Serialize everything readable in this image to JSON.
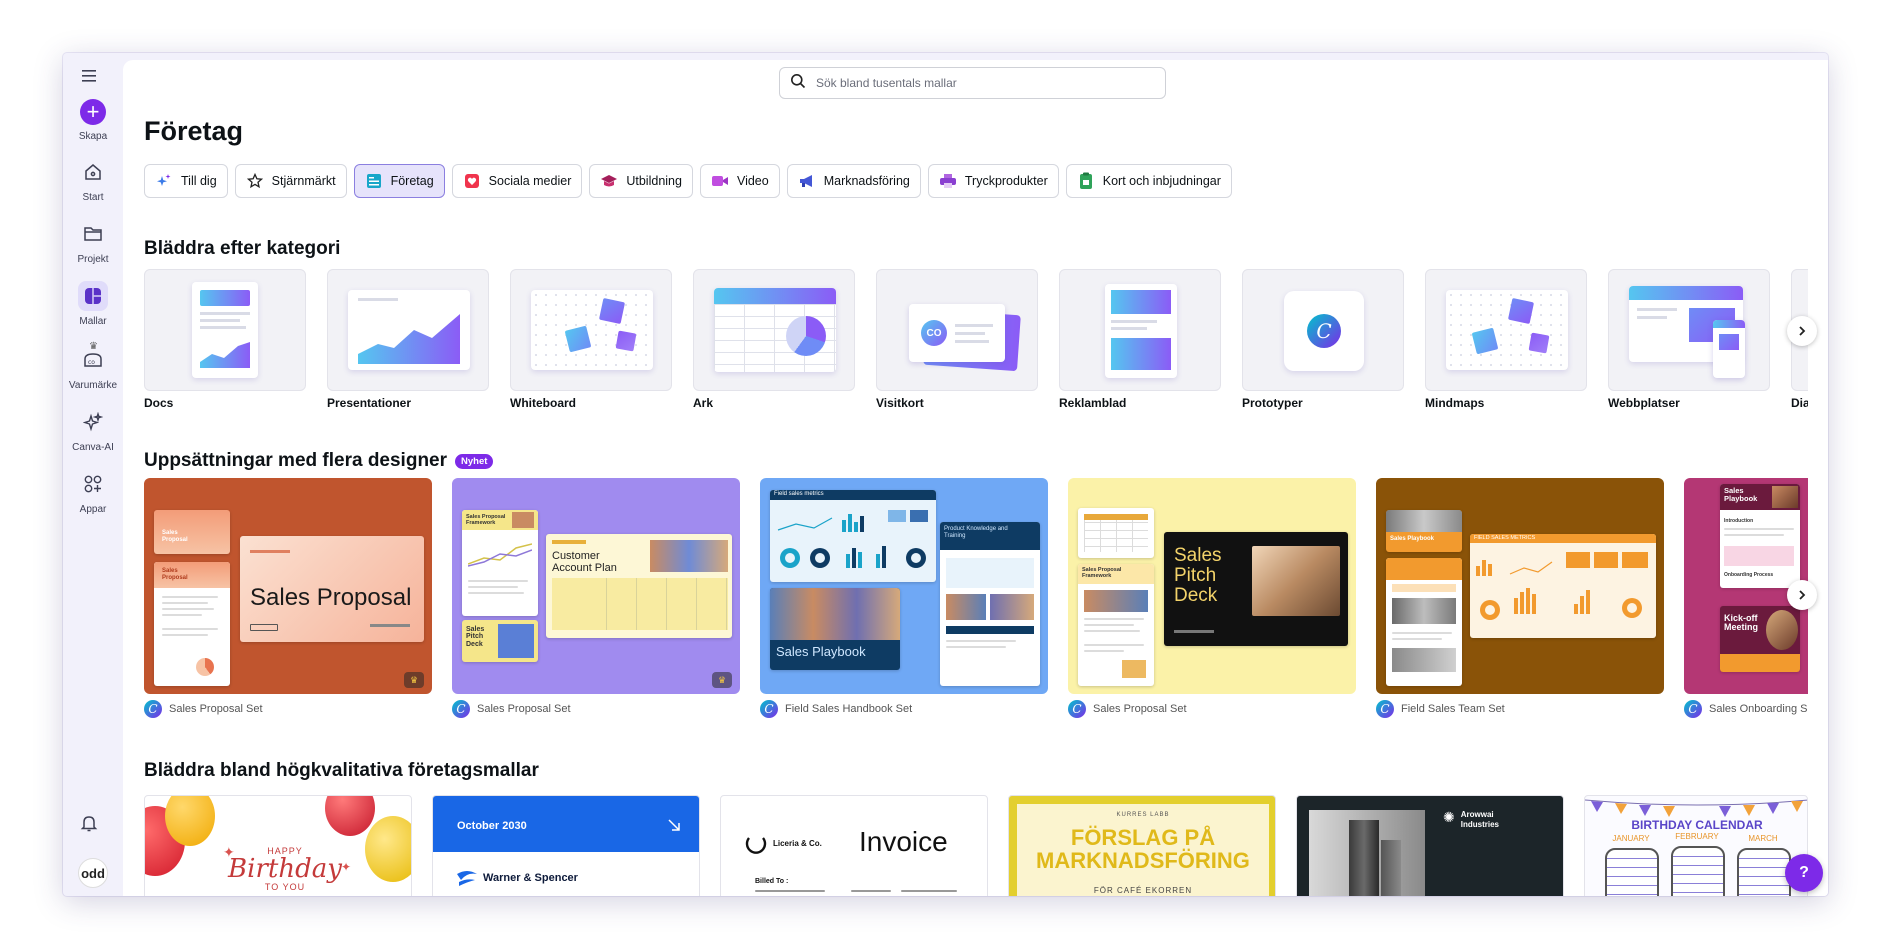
{
  "sidebar": {
    "create": "Skapa",
    "items": [
      {
        "label": "Start"
      },
      {
        "label": "Projekt"
      },
      {
        "label": "Mallar"
      },
      {
        "label": "Varumärke"
      },
      {
        "label": "Canva-AI"
      },
      {
        "label": "Appar"
      }
    ],
    "avatar_text": "odd"
  },
  "search": {
    "placeholder": "Sök bland tusentals mallar"
  },
  "page_title": "Företag",
  "chips": [
    {
      "label": "Till dig",
      "icon": "sparkle-icon"
    },
    {
      "label": "Stjärnmärkt",
      "icon": "star-icon"
    },
    {
      "label": "Företag",
      "icon": "business-icon",
      "active": true
    },
    {
      "label": "Sociala medier",
      "icon": "heart-icon"
    },
    {
      "label": "Utbildning",
      "icon": "graduation-cap-icon"
    },
    {
      "label": "Video",
      "icon": "video-icon"
    },
    {
      "label": "Marknadsföring",
      "icon": "megaphone-icon"
    },
    {
      "label": "Tryckprodukter",
      "icon": "printer-icon"
    },
    {
      "label": "Kort och inbjudningar",
      "icon": "card-icon"
    }
  ],
  "sections": {
    "categories": "Bläddra efter kategori",
    "sets": "Uppsättningar med flera designer",
    "sets_badge": "Nyhet",
    "templates": "Bläddra bland högkvalitativa företagsmallar"
  },
  "categories": [
    {
      "label": "Docs"
    },
    {
      "label": "Presentationer"
    },
    {
      "label": "Whiteboard"
    },
    {
      "label": "Ark"
    },
    {
      "label": "Visitkort",
      "badge": "CO"
    },
    {
      "label": "Reklamblad"
    },
    {
      "label": "Prototyper"
    },
    {
      "label": "Mindmaps"
    },
    {
      "label": "Webbplatser"
    },
    {
      "label": "Diagram"
    }
  ],
  "sets": [
    {
      "label": "Sales Proposal Set",
      "color": "#c0552e",
      "headline": "Sales Proposal",
      "doc_title": "Sales Proposal"
    },
    {
      "label": "Sales Proposal Set",
      "color": "#a08bef",
      "headline": "Customer Account Plan",
      "doc_title": "Sales Proposal Framework",
      "doc_title2": "Sales Pitch Deck"
    },
    {
      "label": "Field Sales Handbook Set",
      "color": "#6fa8f5",
      "headline": "Sales Playbook",
      "doc_title": "Field sales metrics",
      "doc_title2": "Product Knowledge and Training"
    },
    {
      "label": "Sales Proposal Set",
      "color": "#fbf2a8",
      "headline": "Sales Pitch Deck",
      "doc_title": "Sales Proposal Framework"
    },
    {
      "label": "Field Sales Team Set",
      "color": "#8a5308",
      "headline": "Sales Playbook",
      "doc_title": "Field sales metrics"
    },
    {
      "label": "Sales Onboarding Set",
      "color": "#b43774",
      "headline": "Sales Playbook",
      "doc_title": "Introduction",
      "doc_title2": "Kick-off Meeting",
      "doc_title3": "Onboarding Process"
    }
  ],
  "templates": [
    {
      "line1": "HAPPY",
      "line2": "Birthday",
      "line3": "TO YOU"
    },
    {
      "date": "October 2030",
      "brand": "Warner & Spencer"
    },
    {
      "brand": "Liceria & Co.",
      "title": "Invoice",
      "billed": "Billed To :"
    },
    {
      "kicker": "KURRES LABB",
      "title": "FÖRSLAG PÅ MARKNADSFÖRING",
      "sub": "FÖR CAFÉ EKORREN"
    },
    {
      "brand": "Arowwai Industries"
    },
    {
      "title": "BIRTHDAY CALENDAR",
      "months": [
        "JANUARY",
        "FEBRUARY",
        "MARCH"
      ]
    }
  ],
  "help_label": "?"
}
